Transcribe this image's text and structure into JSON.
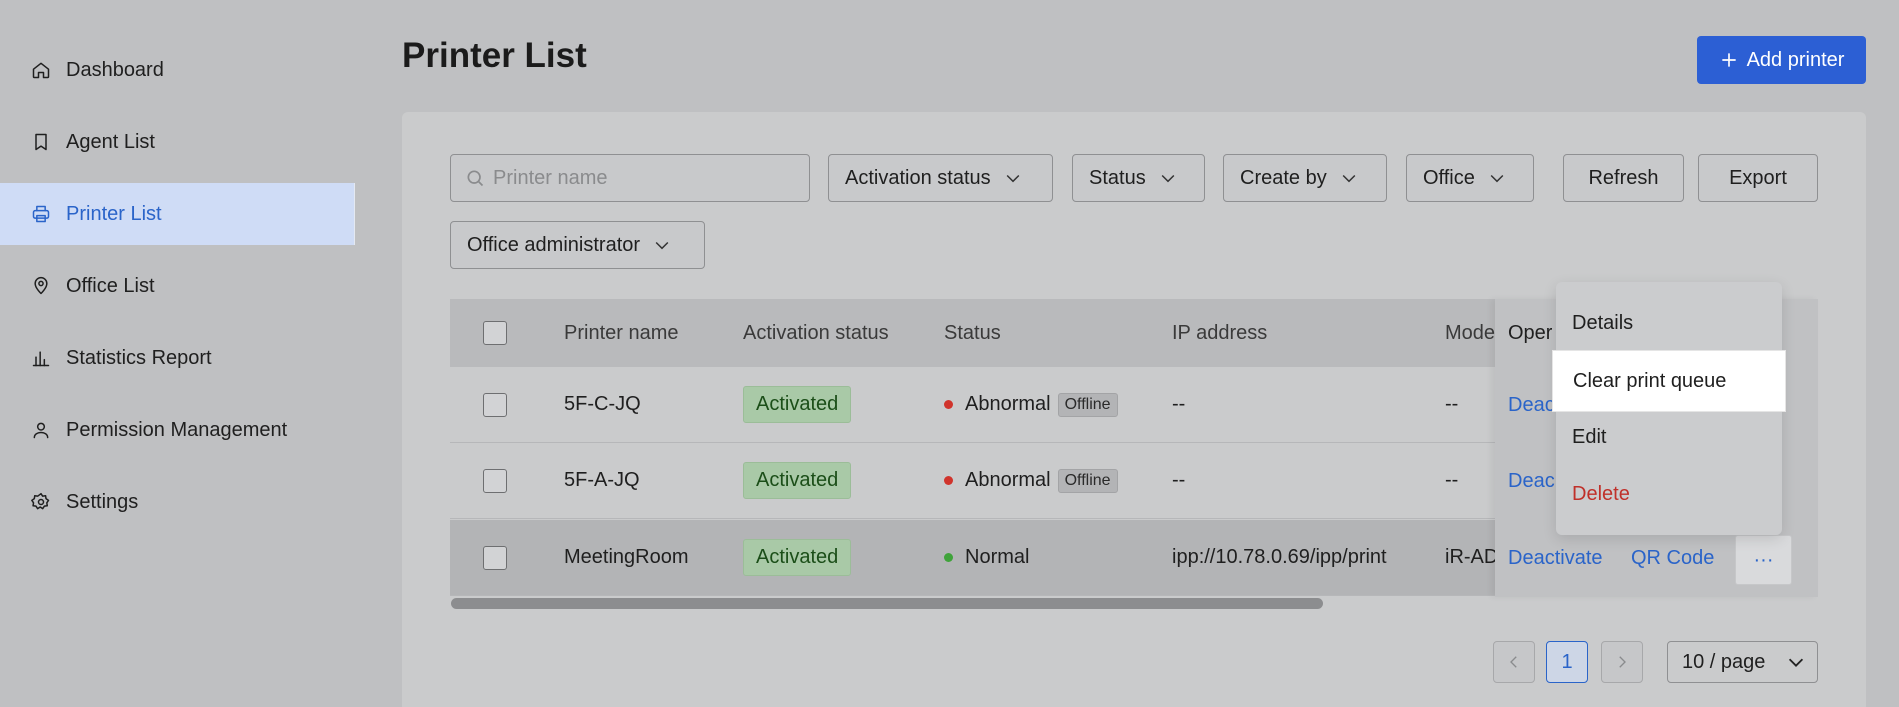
{
  "sidebar": {
    "items": [
      {
        "label": "Dashboard",
        "icon": "home-icon",
        "active": false
      },
      {
        "label": "Agent List",
        "icon": "bookmark-icon",
        "active": false
      },
      {
        "label": "Printer List",
        "icon": "printer-icon",
        "active": true
      },
      {
        "label": "Office List",
        "icon": "location-pin-icon",
        "active": false
      },
      {
        "label": "Statistics Report",
        "icon": "bar-chart-icon",
        "active": false
      },
      {
        "label": "Permission Management",
        "icon": "user-icon",
        "active": false
      },
      {
        "label": "Settings",
        "icon": "gear-icon",
        "active": false
      }
    ]
  },
  "header": {
    "title": "Printer List",
    "add_button_label": "Add printer"
  },
  "filters": {
    "search_placeholder": "Printer name",
    "activation_status": "Activation status",
    "status": "Status",
    "create_by": "Create by",
    "office": "Office",
    "office_admin": "Office administrator",
    "refresh_label": "Refresh",
    "export_label": "Export"
  },
  "table": {
    "columns": [
      "Printer name",
      "Activation status",
      "Status",
      "IP address",
      "Mode",
      "Oper"
    ],
    "rows": [
      {
        "name": "5F-C-JQ",
        "activation": "Activated",
        "status": "Abnormal",
        "status_tag": "Offline",
        "ip": "--",
        "model": "--",
        "op_deactivate": "Deac"
      },
      {
        "name": "5F-A-JQ",
        "activation": "Activated",
        "status": "Abnormal",
        "status_tag": "Offline",
        "ip": "--",
        "model": "--",
        "op_deactivate": "Deac"
      },
      {
        "name": "MeetingRoom",
        "activation": "Activated",
        "status": "Normal",
        "status_tag": "",
        "ip": "ipp://10.78.0.69/ipp/print",
        "model": "iR-AD",
        "op_deactivate": "Deactivate",
        "op_qr": "QR Code",
        "op_more": "···"
      }
    ]
  },
  "menu": {
    "items": [
      "Details",
      "Clear print queue",
      "Edit",
      "Delete"
    ]
  },
  "pagination": {
    "current_page": "1",
    "page_size": "10 / page"
  },
  "colors": {
    "accent": "#2c5fd4",
    "danger": "#c0302a",
    "success": "#3fa33a"
  }
}
